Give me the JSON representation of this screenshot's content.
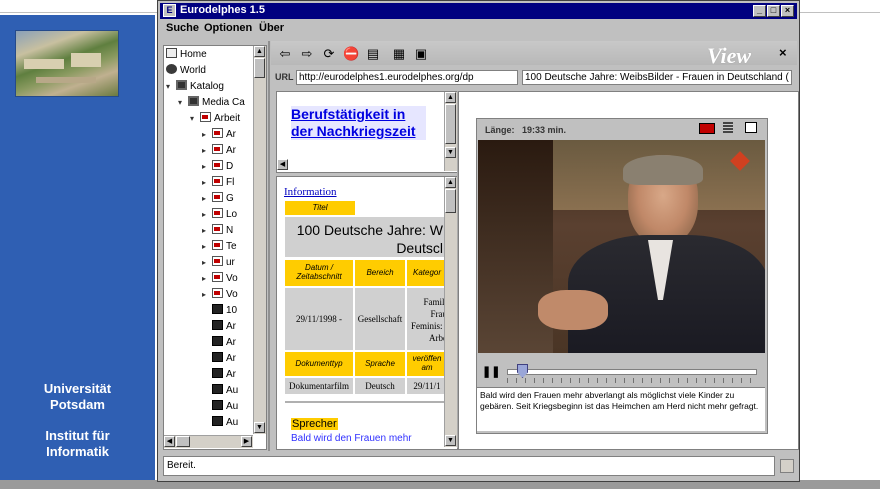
{
  "university": {
    "line1": "Universität",
    "line2": "Potsdam",
    "line3": "Institut für",
    "line4": "Informatik"
  },
  "window": {
    "title": "Eurodelphes 1.5",
    "min": "_",
    "max": "□",
    "close": "×"
  },
  "menu": [
    "Suche",
    "Optionen",
    "Über"
  ],
  "tree": {
    "items": [
      {
        "label": "Home",
        "icon": "home-icon",
        "level": 0
      },
      {
        "label": "World",
        "icon": "world-icon",
        "level": 0
      },
      {
        "label": "Katalog",
        "icon": "catalog-icon",
        "level": 0,
        "expanded": true
      },
      {
        "label": "Media Ca",
        "icon": "catalog-icon",
        "level": 1,
        "expanded": true
      },
      {
        "label": "Arbeit",
        "icon": "document-icon",
        "level": 2,
        "expanded": true
      },
      {
        "label": "Ar",
        "icon": "document-icon",
        "level": 3
      },
      {
        "label": "Ar",
        "icon": "document-icon",
        "level": 3
      },
      {
        "label": "D",
        "icon": "document-icon",
        "level": 3
      },
      {
        "label": "Fl",
        "icon": "document-icon",
        "level": 3
      },
      {
        "label": "G",
        "icon": "document-icon",
        "level": 3
      },
      {
        "label": "Lo",
        "icon": "document-icon",
        "level": 3
      },
      {
        "label": "N",
        "icon": "document-icon",
        "level": 3
      },
      {
        "label": "Te",
        "icon": "document-icon",
        "level": 3
      },
      {
        "label": "ur",
        "icon": "document-icon",
        "level": 3
      },
      {
        "label": "Vo",
        "icon": "document-icon",
        "level": 3
      },
      {
        "label": "Vo",
        "icon": "document-icon",
        "level": 3
      },
      {
        "label": "10",
        "icon": "film-icon",
        "level": 3
      },
      {
        "label": "Ar",
        "icon": "film-icon",
        "level": 3
      },
      {
        "label": "Ar",
        "icon": "film-icon",
        "level": 3
      },
      {
        "label": "Ar",
        "icon": "film-icon",
        "level": 3
      },
      {
        "label": "Ar",
        "icon": "film-icon",
        "level": 3
      },
      {
        "label": "Au",
        "icon": "film-icon",
        "level": 3
      },
      {
        "label": "Au",
        "icon": "film-icon",
        "level": 3
      },
      {
        "label": "Au",
        "icon": "film-icon",
        "level": 3
      }
    ]
  },
  "toolbar": {
    "view_label": "View",
    "close": "×"
  },
  "url": {
    "label": "URL",
    "value": "http://eurodelphes1.eurodelphes.org/dp",
    "title_value": "100 Deutsche Jahre: WeibsBilder - Frauen in Deutschland ("
  },
  "link_pane": {
    "link": "Berufstätigkeit in der Nachkriegszeit"
  },
  "info": {
    "heading": "Information",
    "titel_label": "Titel",
    "titel_value": "100 Deutsche Jahre: W Deutscl",
    "col_headers": [
      "Datum / Zeitabschnitt",
      "Bereich",
      "Kategor"
    ],
    "row1": [
      "29/11/1998 -",
      "Gesellschaft",
      "Famil: Frau Feminis: , Arbe"
    ],
    "col_headers2": [
      "Dokumenttyp",
      "Sprache",
      "veröffen am"
    ],
    "row2": [
      "Dokumentarfilm",
      "Deutsch",
      "29/11/1"
    ],
    "sprecher_label": "Sprecher",
    "sprecher_text": "Bald wird den Frauen mehr"
  },
  "video": {
    "length_label": "Länge:",
    "length_value": "19:33 min.",
    "caption": "Bald wird den Frauen mehr abverlangt als möglichst viele Kinder zu gebären.  Seit Kriegsbeginn ist das Heimchen am Herd nicht mehr gefragt.",
    "progress": 0.02
  },
  "status": {
    "text": "Bereit."
  }
}
